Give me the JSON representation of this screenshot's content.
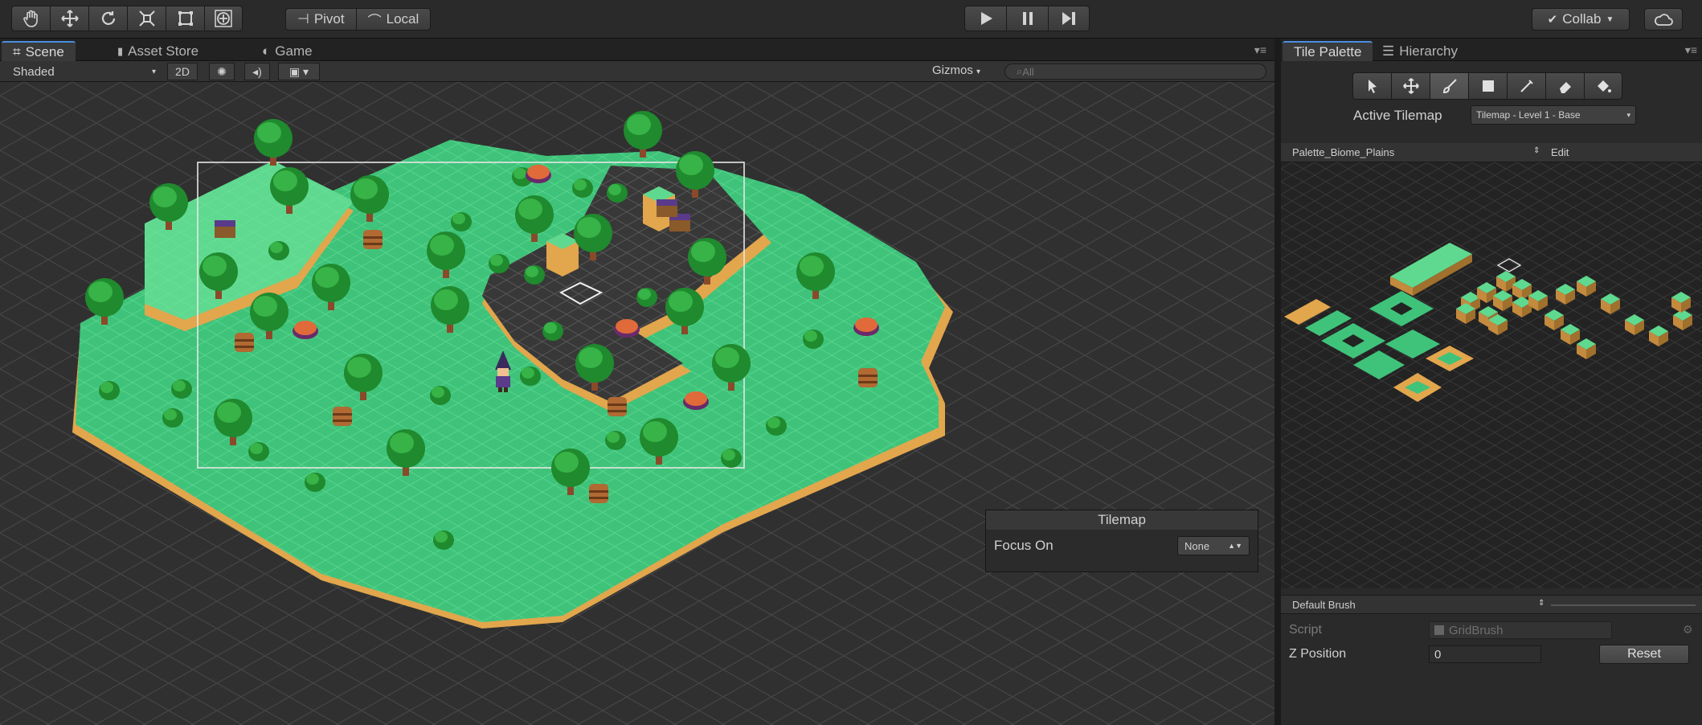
{
  "toolbar": {
    "tools": [
      "hand-icon",
      "move-icon",
      "rotate-icon",
      "scale-icon",
      "rect-tool-icon",
      "transform-icon"
    ],
    "pivot_label": "Pivot",
    "local_label": "Local",
    "collab_label": "Collab"
  },
  "scene": {
    "tabs": [
      {
        "label": "Scene",
        "icon": "scene-icon",
        "active": true
      },
      {
        "label": "Asset Store",
        "icon": "store-icon",
        "active": false
      },
      {
        "label": "Game",
        "icon": "game-icon",
        "active": false
      }
    ],
    "shading_mode": "Shaded",
    "mode_2d": "2D",
    "gizmos_label": "Gizmos",
    "search_placeholder": "All",
    "tilemap_overlay": {
      "title": "Tilemap",
      "focus_label": "Focus On",
      "focus_value": "None"
    }
  },
  "right_panel": {
    "tabs": [
      {
        "label": "Tile Palette",
        "active": true
      },
      {
        "label": "Hierarchy",
        "active": false
      }
    ],
    "palette_tools": [
      "select-icon",
      "move-icon",
      "paintbrush-icon",
      "box-fill-icon",
      "picker-icon",
      "eraser-icon",
      "fill-icon"
    ],
    "active_tilemap_label": "Active Tilemap",
    "active_tilemap_value": "Tilemap - Level 1 - Base",
    "palette_name": "Palette_Biome_Plains",
    "edit_label": "Edit",
    "brush_name": "Default Brush",
    "script_label": "Script",
    "script_value": "GridBrush",
    "z_position_label": "Z Position",
    "z_position_value": "0",
    "reset_label": "Reset"
  },
  "colors": {
    "grass": "#3fc37a",
    "grass_light": "#5fd98f",
    "dirt": "#e2a64d",
    "tree_dark": "#1f8a2e",
    "tree_light": "#38b347",
    "accent_blue": "#4a8fe0"
  }
}
